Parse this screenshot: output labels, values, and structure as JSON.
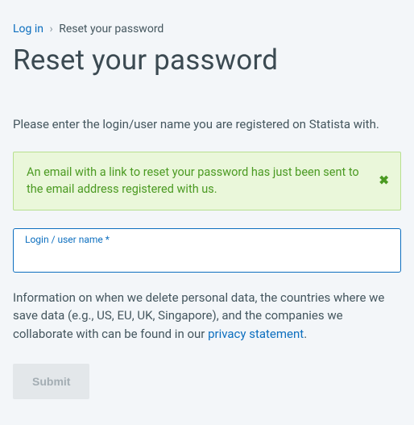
{
  "breadcrumb": {
    "login_label": "Log in",
    "separator": "›",
    "current_label": "Reset your password"
  },
  "page_title": "Reset your password",
  "intro_text": "Please enter the login/user name you are registered on Statista with.",
  "alert": {
    "message": "An email with a link to reset your password has just been sent to the email address registered with us.",
    "close_glyph": "✖"
  },
  "form": {
    "login_field": {
      "label": "Login / user name *",
      "value": ""
    },
    "submit_label": "Submit"
  },
  "info": {
    "prefix": "Information on when we delete personal data, the countries where we save data (e.g., US, EU, UK, Singapore), and the companies we collaborate with can be found in our ",
    "link_text": "privacy statement",
    "suffix": "."
  },
  "colors": {
    "link": "#0d6fbf",
    "success_text": "#4b9a22",
    "success_bg": "#eaf7da",
    "page_bg": "#f3f6f9"
  }
}
